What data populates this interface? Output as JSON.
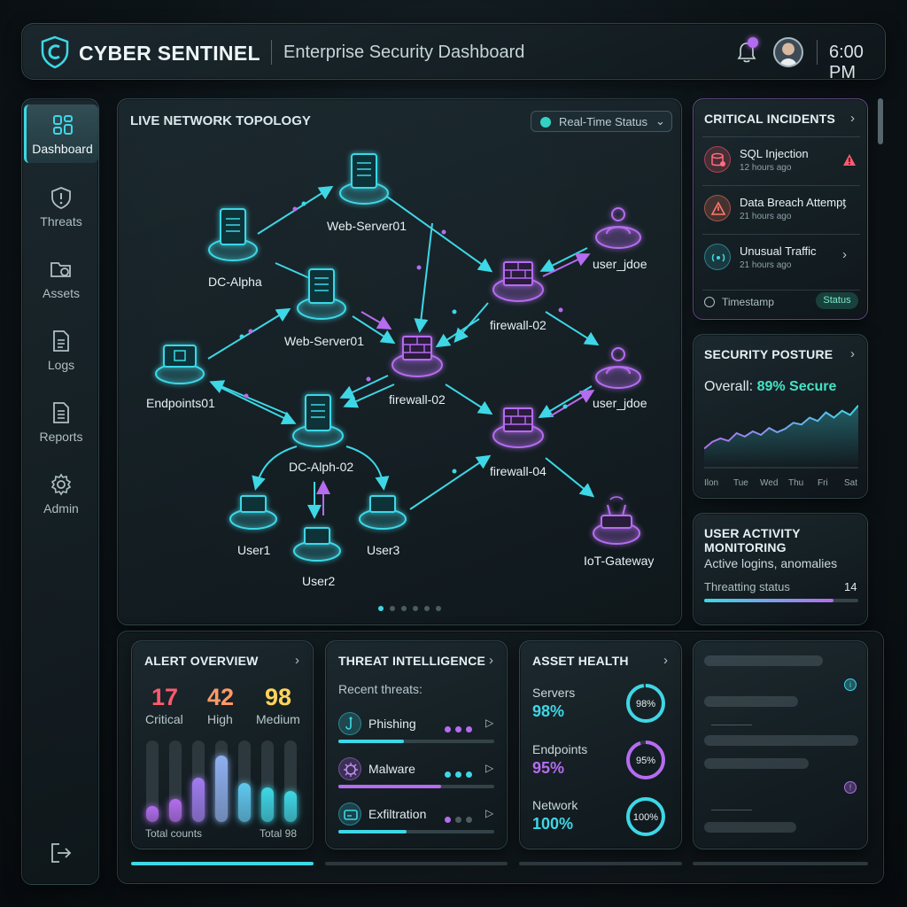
{
  "header": {
    "app_title": "CYBER SENTINEL",
    "subtitle": "Enterprise Security Dashboard",
    "time": "6:00 PM",
    "icons": [
      "shield-logo-icon",
      "bell-icon",
      "avatar"
    ]
  },
  "sidebar": {
    "items": [
      {
        "label": "Dashboard",
        "icon": "grid-icon",
        "active": true
      },
      {
        "label": "Threats",
        "icon": "shield-alert-icon",
        "active": false
      },
      {
        "label": "Assets",
        "icon": "folder-search-icon",
        "active": false
      },
      {
        "label": "Logs",
        "icon": "document-icon",
        "active": false
      },
      {
        "label": "Reports",
        "icon": "report-icon",
        "active": false
      },
      {
        "label": "Admin",
        "icon": "gear-icon",
        "active": false
      }
    ],
    "logout_icon": "logout-icon"
  },
  "topology": {
    "title": "LIVE NETWORK TOPOLOGY",
    "select_value": "Real-Time Status",
    "nodes": {
      "dc_alpha": "DC-Alpha",
      "web_server_top": "Web-Server01",
      "web_server_mid": "Web-Server01",
      "endpoints": "Endpoints01",
      "firewall_center": "firewall-02",
      "firewall_right": "firewall-02",
      "firewall_low": "firewall-04",
      "dc_alph_02": "DC-Alph-02",
      "user1": "User1",
      "user2": "User2",
      "user3": "User3",
      "user_jdoe_top": "user_jdoe",
      "user_jdoe_mid": "user_jdoe",
      "iot_gateway": "IoT-Gateway"
    },
    "pages": 6,
    "active_page": 1
  },
  "incidents": {
    "title": "CRITICAL INCIDENTS",
    "rows": [
      {
        "name": "SQL Injection",
        "time": "12 hours ago",
        "icon": "database-bug-icon",
        "end_icon": "warning-icon"
      },
      {
        "name": "Data Breach Attempt",
        "time": "21 hours ago",
        "icon": "alert-triangle-icon",
        "end_icon": "chevron-right-icon"
      },
      {
        "name": "Unusual Traffic",
        "time": "21 hours ago",
        "icon": "signal-icon",
        "end_icon": "chevron-right-icon"
      }
    ],
    "footer_label": "Timestamp",
    "footer_status": "Status"
  },
  "posture": {
    "title": "SECURITY POSTURE",
    "overall_label": "Overall:",
    "overall_value": "89% Secure",
    "days": [
      "Ilon",
      "Tue",
      "Wed",
      "Thu",
      "Fri",
      "Sat"
    ],
    "trend": [
      22,
      30,
      34,
      31,
      40,
      36,
      42,
      38,
      46,
      41,
      45,
      52,
      50,
      58,
      54,
      64,
      58,
      66,
      61,
      72
    ]
  },
  "activity": {
    "title": "USER ACTIVITY MONITORING",
    "description": "Active logins, anomalies",
    "status_label": "Threatting status",
    "count": "14",
    "progress": 0.84
  },
  "alerts": {
    "title": "ALERT OVERVIEW",
    "stats": [
      {
        "value": "17",
        "label": "Critical",
        "color": "#ff5a6e"
      },
      {
        "value": "42",
        "label": "High",
        "color": "#ff9a66"
      },
      {
        "value": "98",
        "label": "Medium",
        "color": "#ffd45a"
      }
    ],
    "bars": [
      0.2,
      0.28,
      0.54,
      0.82,
      0.48,
      0.42,
      0.38
    ],
    "footer_left": "Total counts",
    "footer_right": "Total 98"
  },
  "threat_intel": {
    "title": "THREAT INTELLIGENCE",
    "subtitle": "Recent threats:",
    "rows": [
      {
        "name": "Phishing",
        "icon": "hook-icon",
        "progress": 0.42,
        "dots": 3,
        "color": "#3ed7e6"
      },
      {
        "name": "Malware",
        "icon": "bug-icon",
        "progress": 0.66,
        "dots": 3,
        "color": "#b56cf0"
      },
      {
        "name": "Exfiltration",
        "icon": "drive-icon",
        "progress": 0.44,
        "dots": 1,
        "color": "#3ed7e6"
      }
    ]
  },
  "asset_health": {
    "title": "ASSET HEALTH",
    "rows": [
      {
        "name": "Servers",
        "value": "98%",
        "ring_label": "98%",
        "level": 0.98,
        "color": "#3ed7e6"
      },
      {
        "name": "Endpoints",
        "value": "95%",
        "ring_label": "95%",
        "level": 0.95,
        "color": "#b56cf0"
      },
      {
        "name": "Network",
        "value": "100%",
        "ring_label": "100%",
        "level": 1.0,
        "color": "#3ed7e6"
      }
    ]
  },
  "colors": {
    "accent_cyan": "#3ed7e6",
    "accent_purple": "#b56cf0",
    "secure_green": "#44e3c5"
  }
}
